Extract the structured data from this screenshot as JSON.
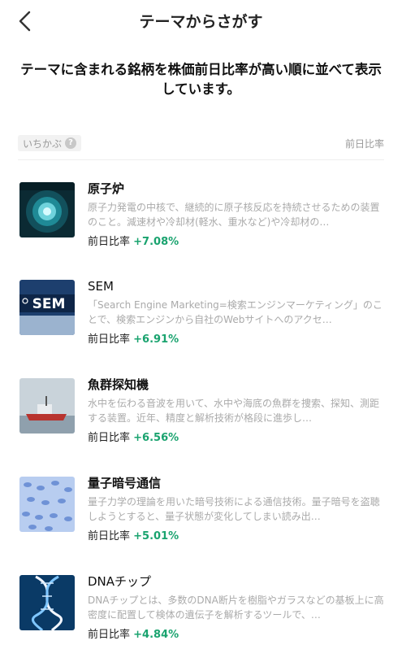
{
  "header": {
    "title": "テーマからさがす",
    "back_icon": "chevron-left-icon"
  },
  "intro": "テーマに含まれる銘柄を株価前日比率が高い順に並べて表示しています。",
  "list_header": {
    "left_label": "いちかぶ",
    "help_glyph": "?",
    "right_label": "前日比率"
  },
  "colors": {
    "positive": "#1aa36f",
    "muted": "#aaaaaa"
  },
  "items": [
    {
      "title": "原子炉",
      "description": "原子力発電の中核で、継続的に原子核反応を持続させるための装置のこと。減速材や冷却材(軽水、重水など)や冷却材の…",
      "change_label": "前日比率",
      "change_value": "+7.08%"
    },
    {
      "title": "SEM",
      "description": "「Search Engine Marketing=検索エンジンマーケティング」のことで、検索エンジンから自社のWebサイトへのアクセ…",
      "change_label": "前日比率",
      "change_value": "+6.91%",
      "thumb_text": "SEM"
    },
    {
      "title": "魚群探知機",
      "description": "水中を伝わる音波を用いて、水中や海底の魚群を捜索、探知、測距する装置。近年、精度と解析技術が格段に進歩し…",
      "change_label": "前日比率",
      "change_value": "+6.56%"
    },
    {
      "title": "量子暗号通信",
      "description": "量子力学の理論を用いた暗号技術による通信技術。量子暗号を盗聴しようとすると、量子状態が変化してしまい読み出…",
      "change_label": "前日比率",
      "change_value": "+5.01%"
    },
    {
      "title": "DNAチップ",
      "description": "DNAチップとは、多数のDNA断片を樹脂やガラスなどの基板上に高密度に配置して検体の遺伝子を解析するツールで、…",
      "change_label": "前日比率",
      "change_value": "+4.84%"
    }
  ]
}
